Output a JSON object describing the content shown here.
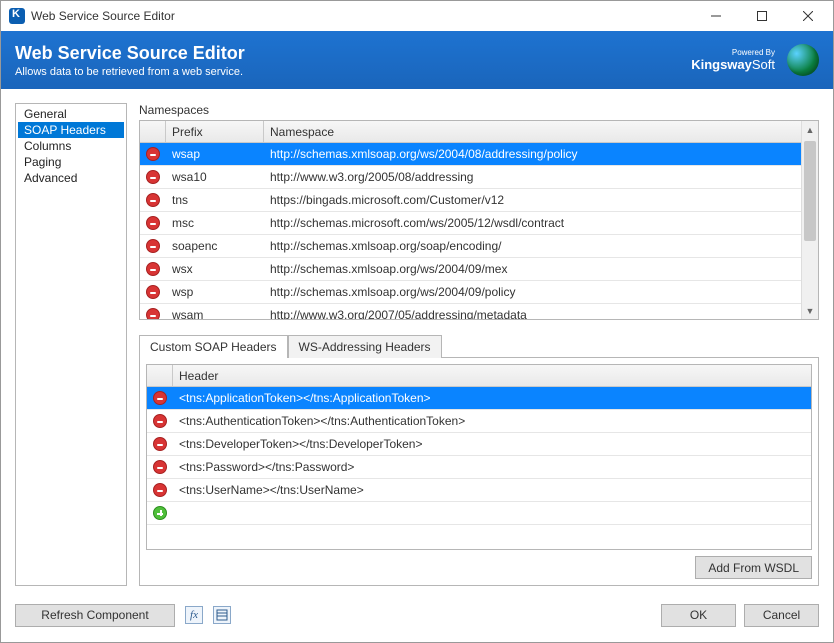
{
  "window": {
    "title": "Web Service Source Editor"
  },
  "header": {
    "title": "Web Service Source Editor",
    "subtitle": "Allows data to be retrieved from a web service.",
    "powered_by": "Powered By",
    "brand_pre": "Kingsway",
    "brand_post": "Soft"
  },
  "nav": {
    "items": [
      {
        "label": "General"
      },
      {
        "label": "SOAP Headers"
      },
      {
        "label": "Columns"
      },
      {
        "label": "Paging"
      },
      {
        "label": "Advanced"
      }
    ],
    "selected": 1
  },
  "namespaces": {
    "label": "Namespaces",
    "col_prefix": "Prefix",
    "col_namespace": "Namespace",
    "rows": [
      {
        "prefix": "wsap",
        "ns": "http://schemas.xmlsoap.org/ws/2004/08/addressing/policy"
      },
      {
        "prefix": "wsa10",
        "ns": "http://www.w3.org/2005/08/addressing"
      },
      {
        "prefix": "tns",
        "ns": "https://bingads.microsoft.com/Customer/v12"
      },
      {
        "prefix": "msc",
        "ns": "http://schemas.microsoft.com/ws/2005/12/wsdl/contract"
      },
      {
        "prefix": "soapenc",
        "ns": "http://schemas.xmlsoap.org/soap/encoding/"
      },
      {
        "prefix": "wsx",
        "ns": "http://schemas.xmlsoap.org/ws/2004/09/mex"
      },
      {
        "prefix": "wsp",
        "ns": "http://schemas.xmlsoap.org/ws/2004/09/policy"
      },
      {
        "prefix": "wsam",
        "ns": "http://www.w3.org/2007/05/addressing/metadata"
      }
    ],
    "selected": 0
  },
  "tabs": {
    "items": [
      {
        "label": "Custom SOAP Headers"
      },
      {
        "label": "WS-Addressing Headers"
      }
    ],
    "active": 0
  },
  "headers": {
    "col_header": "Header",
    "rows": [
      {
        "text": "<tns:ApplicationToken></tns:ApplicationToken>"
      },
      {
        "text": "<tns:AuthenticationToken></tns:AuthenticationToken>"
      },
      {
        "text": "<tns:DeveloperToken></tns:DeveloperToken>"
      },
      {
        "text": "<tns:Password></tns:Password>"
      },
      {
        "text": "<tns:UserName></tns:UserName>"
      }
    ],
    "selected": 0,
    "add_from_wsdl": "Add From WSDL"
  },
  "footer": {
    "refresh": "Refresh Component",
    "ok": "OK",
    "cancel": "Cancel"
  }
}
